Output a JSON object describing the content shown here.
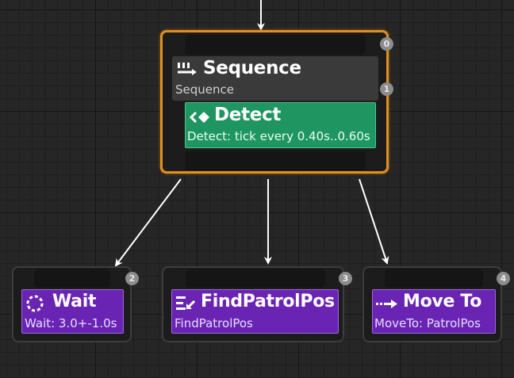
{
  "nodes": {
    "sequence": {
      "title": "Sequence",
      "subtitle": "Sequence",
      "index": "0",
      "icon": "sequence-icon"
    },
    "detect": {
      "title": "Detect",
      "subtitle": "Detect: tick every 0.40s..0.60s",
      "index": "1",
      "icon": "service-icon"
    },
    "wait": {
      "title": "Wait",
      "subtitle": "Wait: 3.0+-1.0s",
      "index": "2",
      "icon": "wait-icon"
    },
    "find_patrol_pos": {
      "title": "FindPatrolPos",
      "subtitle": "FindPatrolPos",
      "index": "3",
      "icon": "task-icon"
    },
    "move_to": {
      "title": "Move To",
      "subtitle": "MoveTo: PatrolPos",
      "index": "4",
      "icon": "move-arrow-icon"
    }
  },
  "colors": {
    "background": "#262626",
    "selection_outline": "#e0901e",
    "task_purple": "#6a24b4",
    "service_green": "#1f9561",
    "wire": "#ffffff"
  }
}
